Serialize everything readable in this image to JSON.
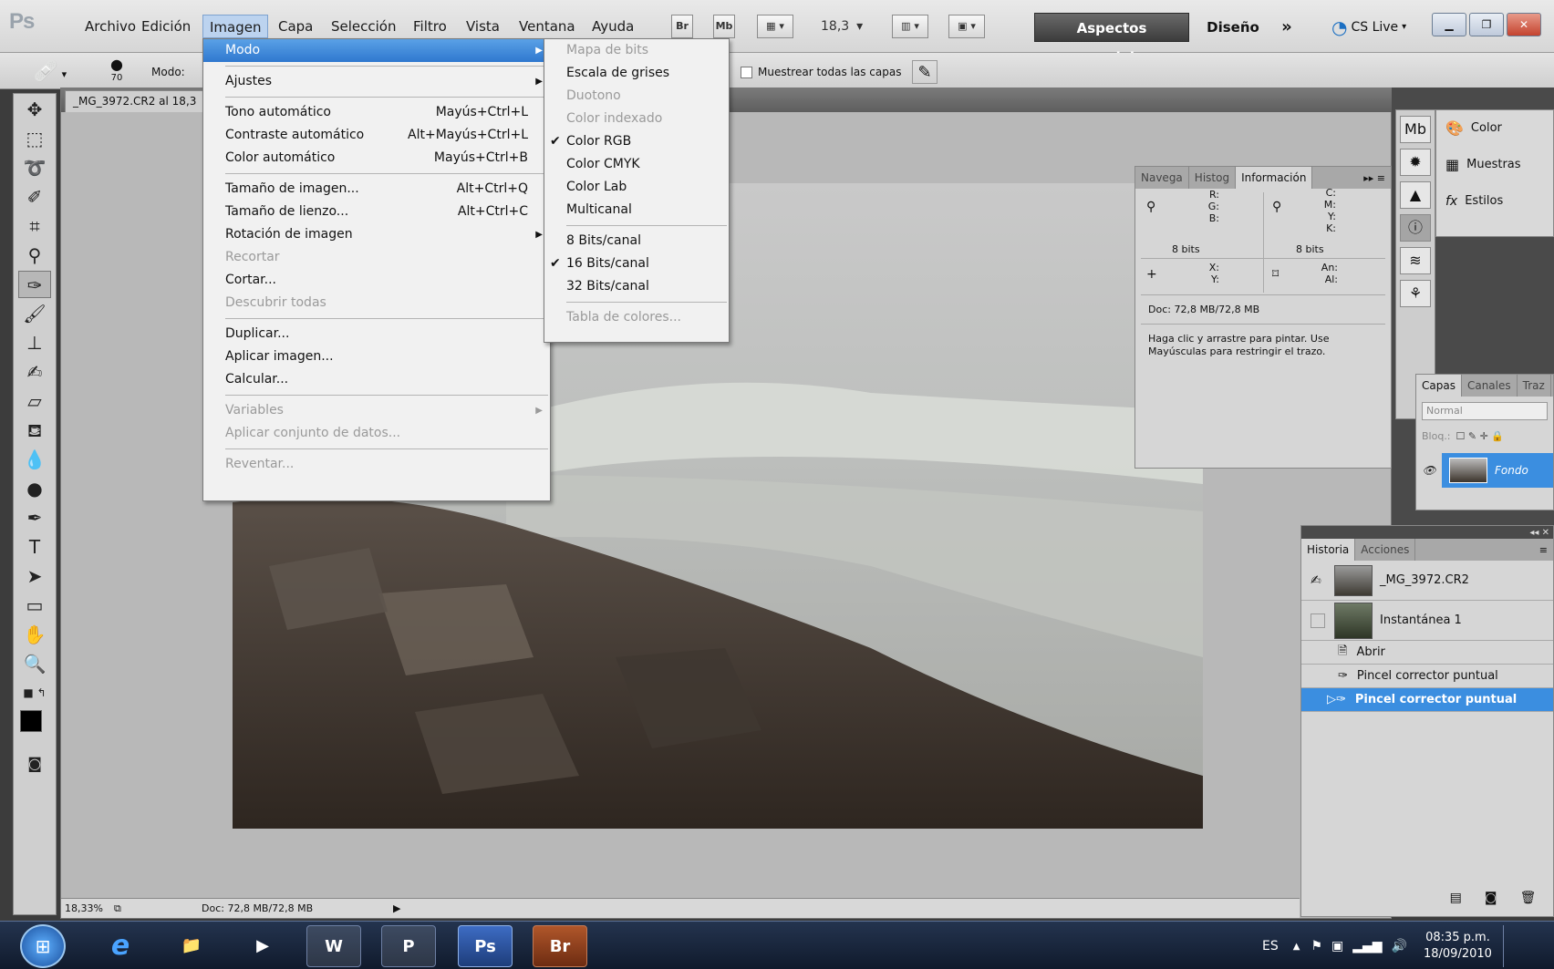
{
  "menubar": {
    "logo": "Ps",
    "items": [
      "Archivo",
      "Edición",
      "Imagen",
      "Capa",
      "Selección",
      "Filtro",
      "Vista",
      "Ventana",
      "Ayuda"
    ],
    "bridge": "Br",
    "minibridge": "Mb",
    "zoom": "18,3",
    "workspace_active": "Aspectos esenciales",
    "workspace_other": "Diseño",
    "more": "»",
    "cslive": "CS Live"
  },
  "options_bar": {
    "brush_size": "70",
    "mode_label": "Modo:",
    "sample_all_label": "Muestrear todas las capas"
  },
  "document": {
    "tab_title": "_MG_3972.CR2 al 18,3",
    "zoom_status": "18,33%",
    "doc_status": "Doc: 72,8 MB/72,8 MB"
  },
  "imagen_menu": {
    "items": [
      {
        "label": "Modo",
        "state": "highlighted",
        "submenu": true
      },
      {
        "label": "Ajustes",
        "submenu": true
      },
      {
        "label": "Tono automático",
        "shortcut": "Mayús+Ctrl+L"
      },
      {
        "label": "Contraste automático",
        "shortcut": "Alt+Mayús+Ctrl+L"
      },
      {
        "label": "Color automático",
        "shortcut": "Mayús+Ctrl+B"
      },
      {
        "label": "Tamaño de imagen...",
        "shortcut": "Alt+Ctrl+Q"
      },
      {
        "label": "Tamaño de lienzo...",
        "shortcut": "Alt+Ctrl+C"
      },
      {
        "label": "Rotación de imagen",
        "submenu": true
      },
      {
        "label": "Recortar",
        "state": "disabled"
      },
      {
        "label": "Cortar..."
      },
      {
        "label": "Descubrir todas",
        "state": "disabled"
      },
      {
        "label": "Duplicar..."
      },
      {
        "label": "Aplicar imagen..."
      },
      {
        "label": "Calcular..."
      },
      {
        "label": "Variables",
        "state": "disabled",
        "submenu": true
      },
      {
        "label": "Aplicar conjunto de datos...",
        "state": "disabled"
      },
      {
        "label": "Reventar...",
        "state": "disabled"
      }
    ]
  },
  "modo_submenu": {
    "items": [
      {
        "label": "Mapa de bits",
        "state": "disabled"
      },
      {
        "label": "Escala de grises"
      },
      {
        "label": "Duotono",
        "state": "disabled"
      },
      {
        "label": "Color indexado",
        "state": "disabled"
      },
      {
        "label": "Color RGB",
        "checked": true
      },
      {
        "label": "Color CMYK"
      },
      {
        "label": "Color Lab"
      },
      {
        "label": "Multicanal"
      },
      {
        "label": "8 Bits/canal"
      },
      {
        "label": "16 Bits/canal",
        "checked": true
      },
      {
        "label": "32 Bits/canal"
      },
      {
        "label": "Tabla de colores...",
        "state": "disabled"
      }
    ],
    "check_glyph": "✔"
  },
  "info_panel": {
    "tabs": [
      "Navega",
      "Histog",
      "Información"
    ],
    "rgb_labels": "R:\nG:\nB:",
    "cmyk_labels": "C:\nM:\nY:\nK:",
    "bits_left": "8 bits",
    "bits_right": "8 bits",
    "xy_labels": "X:\nY:",
    "size_labels": "An:\nAl:",
    "doc": "Doc: 72,8 MB/72,8 MB",
    "hint": "Haga clic y arrastre para pintar. Use Mayúsculas para restringir el trazo."
  },
  "right_panels": {
    "color": "Color",
    "muestras": "Muestras",
    "estilos": "Estilos"
  },
  "layers_panel": {
    "tabs": [
      "Capas",
      "Canales",
      "Traz"
    ],
    "blend_mode": "Normal",
    "lock_label": "Bloq.:",
    "layer_name": "Fondo"
  },
  "history_panel": {
    "tabs": [
      "Historia",
      "Acciones"
    ],
    "snapshot": "_MG_3972.CR2",
    "snapshot2": "Instantánea 1",
    "steps": [
      "Abrir",
      "Pincel corrector puntual",
      "Pincel corrector puntual"
    ]
  },
  "taskbar": {
    "apps": [
      "IE",
      "Explorer",
      "Media",
      "Word",
      "PowerPoint",
      "Ps",
      "Br"
    ],
    "lang": "ES",
    "time": "08:35 p.m.",
    "date": "18/09/2010"
  },
  "colors": {
    "highlight": "#2f78cf",
    "history_selected": "#3b8ee0",
    "workspace_button": "#4a4a4a"
  }
}
